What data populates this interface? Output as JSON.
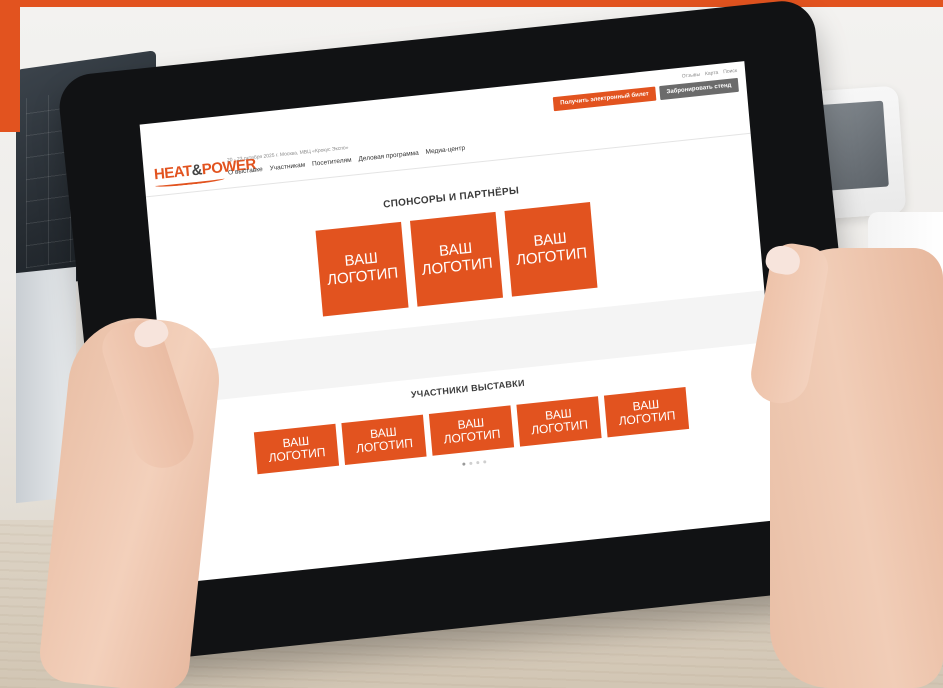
{
  "site": {
    "utility_links": [
      "Отзывы",
      "Карта",
      "Поиск"
    ],
    "cta": {
      "ticket_label": "Получить электронный билет",
      "stand_label": "Забронировать стенд"
    },
    "logo": {
      "part1": "HEAT",
      "amp": "&",
      "part2": "POWER"
    },
    "event_info": "20 - 23 октября 2025 г. Москва, МВЦ «Крокус Экспо»",
    "nav": [
      "О выставке",
      "Участникам",
      "Посетителям",
      "Деловая программа",
      "Медиа-центр"
    ]
  },
  "sponsors": {
    "title": "СПОНСОРЫ И ПАРТНЁРЫ",
    "tiles": [
      "ВАШ\nЛОГОТИП",
      "ВАШ\nЛОГОТИП",
      "ВАШ\nЛОГОТИП"
    ]
  },
  "exhibitors": {
    "title": "УЧАСТНИКИ ВЫСТАВКИ",
    "tiles": [
      "ВАШ\nЛОГОТИП",
      "ВАШ\nЛОГОТИП",
      "ВАШ\nЛОГОТИП",
      "ВАШ\nЛОГОТИП",
      "ВАШ\nЛОГОТИП"
    ]
  },
  "pager": {
    "count": 4,
    "active": 0
  },
  "colors": {
    "brand_orange": "#e2531f",
    "button_gray": "#6b6b6b",
    "bezel": "#111214"
  }
}
